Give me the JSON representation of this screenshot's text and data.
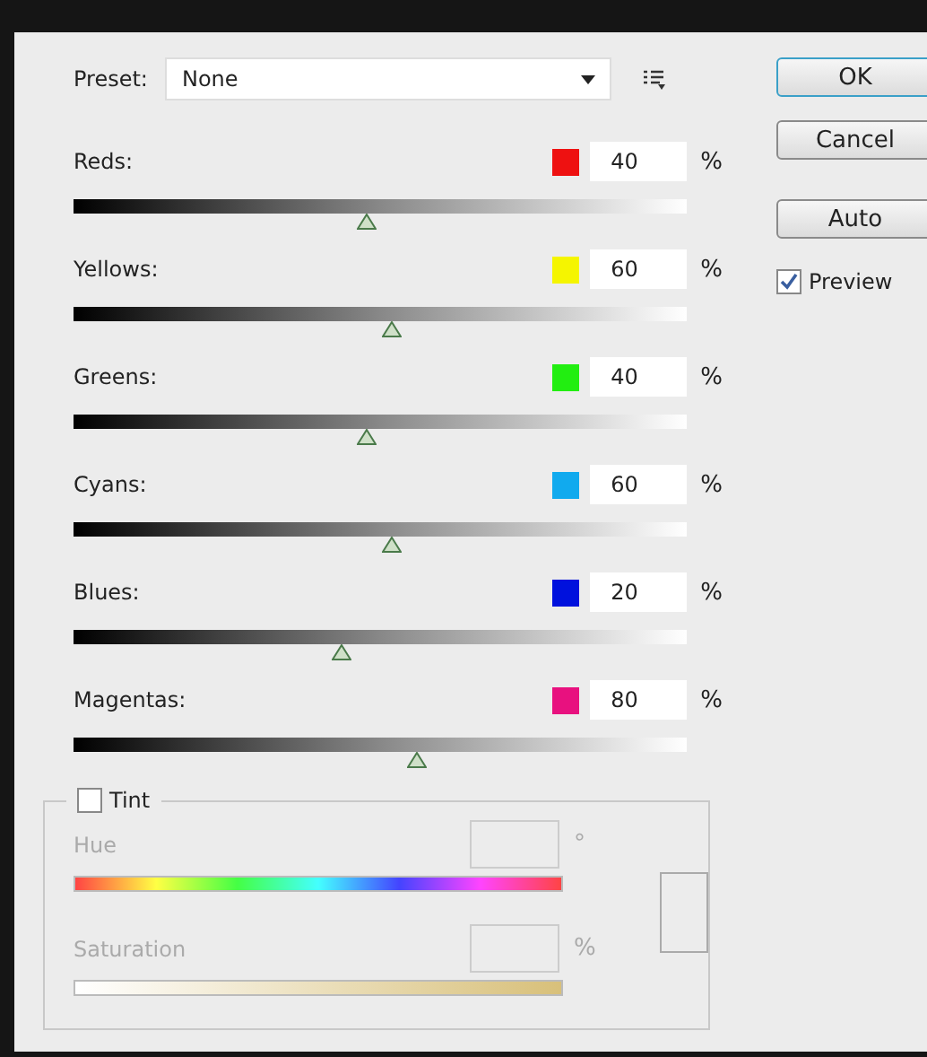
{
  "preset": {
    "label": "Preset:",
    "value": "None"
  },
  "buttons": [
    {
      "label": "OK",
      "default": true
    },
    {
      "label": "Cancel",
      "default": false
    },
    {
      "label": "Auto",
      "default": false
    }
  ],
  "preview": {
    "label": "Preview",
    "checked": true
  },
  "channels": [
    {
      "name": "Reds:",
      "color": "#ee1111",
      "value": "40",
      "unit": "%",
      "level": 0.48
    },
    {
      "name": "Yellows:",
      "color": "#f5f500",
      "value": "60",
      "unit": "%",
      "level": 0.52
    },
    {
      "name": "Greens:",
      "color": "#22ee11",
      "value": "40",
      "unit": "%",
      "level": 0.48
    },
    {
      "name": "Cyans:",
      "color": "#11aaee",
      "value": "60",
      "unit": "%",
      "level": 0.52
    },
    {
      "name": "Blues:",
      "color": "#0011dd",
      "value": "20",
      "unit": "%",
      "level": 0.44
    },
    {
      "name": "Magentas:",
      "color": "#e8117f",
      "value": "80",
      "unit": "%",
      "level": 0.56
    }
  ],
  "tint": {
    "label": "Tint",
    "checked": false,
    "disabled": true,
    "hue": {
      "label": "Hue",
      "unit": "°"
    },
    "saturation": {
      "label": "Saturation",
      "unit": "%"
    }
  }
}
